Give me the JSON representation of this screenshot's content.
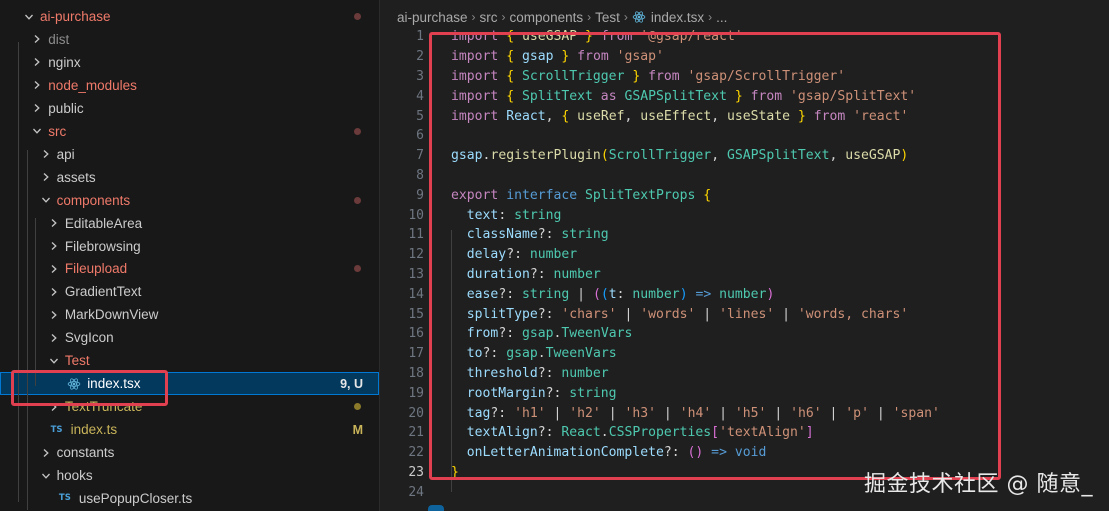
{
  "explorer": {
    "items": [
      {
        "label": "ai-purchase",
        "depth": 0,
        "kind": "folder-open",
        "color": "red",
        "status": "dot"
      },
      {
        "label": "dist",
        "depth": 1,
        "kind": "folder",
        "color": "grey"
      },
      {
        "label": "nginx",
        "depth": 1,
        "kind": "folder",
        "color": "normal"
      },
      {
        "label": "node_modules",
        "depth": 1,
        "kind": "folder",
        "color": "red"
      },
      {
        "label": "public",
        "depth": 1,
        "kind": "folder",
        "color": "normal"
      },
      {
        "label": "src",
        "depth": 1,
        "kind": "folder-open",
        "color": "red",
        "status": "dot"
      },
      {
        "label": "api",
        "depth": 2,
        "kind": "folder",
        "color": "normal"
      },
      {
        "label": "assets",
        "depth": 2,
        "kind": "folder",
        "color": "normal"
      },
      {
        "label": "components",
        "depth": 2,
        "kind": "folder-open",
        "color": "red",
        "status": "dot"
      },
      {
        "label": "EditableArea",
        "depth": 3,
        "kind": "folder",
        "color": "normal"
      },
      {
        "label": "Filebrowsing",
        "depth": 3,
        "kind": "folder",
        "color": "normal"
      },
      {
        "label": "Fileupload",
        "depth": 3,
        "kind": "folder",
        "color": "red",
        "status": "dot"
      },
      {
        "label": "GradientText",
        "depth": 3,
        "kind": "folder",
        "color": "normal"
      },
      {
        "label": "MarkDownView",
        "depth": 3,
        "kind": "folder",
        "color": "normal"
      },
      {
        "label": "SvgIcon",
        "depth": 3,
        "kind": "folder",
        "color": "normal"
      },
      {
        "label": "Test",
        "depth": 3,
        "kind": "folder-open",
        "color": "red"
      },
      {
        "label": "index.tsx",
        "depth": 4,
        "kind": "react-file",
        "color": "normal",
        "selected": true,
        "tag": "9, U"
      },
      {
        "label": "TextTruncate",
        "depth": 3,
        "kind": "folder",
        "color": "yellow",
        "status": "dot-yellow"
      },
      {
        "label": "index.ts",
        "depth": 2,
        "kind": "ts-file",
        "color": "yellow",
        "tag": "M"
      },
      {
        "label": "constants",
        "depth": 2,
        "kind": "folder",
        "color": "normal"
      },
      {
        "label": "hooks",
        "depth": 2,
        "kind": "folder-open",
        "color": "normal"
      },
      {
        "label": "usePopupCloser.ts",
        "depth": 3,
        "kind": "ts-file",
        "color": "normal"
      }
    ],
    "ts_badge": "TS"
  },
  "breadcrumb": [
    "ai-purchase",
    "src",
    "components",
    "Test",
    "index.tsx",
    "..."
  ],
  "code": {
    "lines": [
      [
        [
          "k",
          "import "
        ],
        [
          "b1",
          "{ "
        ],
        [
          "f",
          "useGSAP"
        ],
        [
          "b1",
          " } "
        ],
        [
          "k",
          "from "
        ],
        [
          "s",
          "'@gsap/react'"
        ]
      ],
      [
        [
          "k",
          "import "
        ],
        [
          "b1",
          "{ "
        ],
        [
          "v",
          "gsap"
        ],
        [
          "b1",
          " } "
        ],
        [
          "k",
          "from "
        ],
        [
          "s",
          "'gsap'"
        ]
      ],
      [
        [
          "k",
          "import "
        ],
        [
          "b1",
          "{ "
        ],
        [
          "t",
          "ScrollTrigger"
        ],
        [
          "b1",
          " } "
        ],
        [
          "k",
          "from "
        ],
        [
          "s",
          "'gsap/ScrollTrigger'"
        ]
      ],
      [
        [
          "k",
          "import "
        ],
        [
          "b1",
          "{ "
        ],
        [
          "t",
          "SplitText"
        ],
        [
          "k",
          " as "
        ],
        [
          "t",
          "GSAPSplitText"
        ],
        [
          "b1",
          " } "
        ],
        [
          "k",
          "from "
        ],
        [
          "s",
          "'gsap/SplitText'"
        ]
      ],
      [
        [
          "k",
          "import "
        ],
        [
          "v",
          "React"
        ],
        [
          "p",
          ", "
        ],
        [
          "b1",
          "{ "
        ],
        [
          "f",
          "useRef"
        ],
        [
          "p",
          ", "
        ],
        [
          "f",
          "useEffect"
        ],
        [
          "p",
          ", "
        ],
        [
          "f",
          "useState"
        ],
        [
          "b1",
          " } "
        ],
        [
          "k",
          "from "
        ],
        [
          "s",
          "'react'"
        ]
      ],
      [],
      [
        [
          "v",
          "gsap"
        ],
        [
          "p",
          "."
        ],
        [
          "f",
          "registerPlugin"
        ],
        [
          "b1",
          "("
        ],
        [
          "t",
          "ScrollTrigger"
        ],
        [
          "p",
          ", "
        ],
        [
          "t",
          "GSAPSplitText"
        ],
        [
          "p",
          ", "
        ],
        [
          "f",
          "useGSAP"
        ],
        [
          "b1",
          ")"
        ]
      ],
      [],
      [
        [
          "k",
          "export "
        ],
        [
          "kb",
          "interface "
        ],
        [
          "t",
          "SplitTextProps "
        ],
        [
          "b1",
          "{"
        ]
      ],
      [
        [
          "v",
          "  text"
        ],
        [
          "p",
          ": "
        ],
        [
          "t",
          "string"
        ]
      ],
      [
        [
          "v",
          "  className"
        ],
        [
          "p",
          "?: "
        ],
        [
          "t",
          "string"
        ]
      ],
      [
        [
          "v",
          "  delay"
        ],
        [
          "p",
          "?: "
        ],
        [
          "t",
          "number"
        ]
      ],
      [
        [
          "v",
          "  duration"
        ],
        [
          "p",
          "?: "
        ],
        [
          "t",
          "number"
        ]
      ],
      [
        [
          "v",
          "  ease"
        ],
        [
          "p",
          "?: "
        ],
        [
          "t",
          "string"
        ],
        [
          "p",
          " | "
        ],
        [
          "b2",
          "("
        ],
        [
          "b3",
          "("
        ],
        [
          "v",
          "t"
        ],
        [
          "p",
          ": "
        ],
        [
          "t",
          "number"
        ],
        [
          "b3",
          ")"
        ],
        [
          "kb",
          " => "
        ],
        [
          "t",
          "number"
        ],
        [
          "b2",
          ")"
        ]
      ],
      [
        [
          "v",
          "  splitType"
        ],
        [
          "p",
          "?: "
        ],
        [
          "s",
          "'chars'"
        ],
        [
          "p",
          " | "
        ],
        [
          "s",
          "'words'"
        ],
        [
          "p",
          " | "
        ],
        [
          "s",
          "'lines'"
        ],
        [
          "p",
          " | "
        ],
        [
          "s",
          "'words, chars'"
        ]
      ],
      [
        [
          "v",
          "  from"
        ],
        [
          "p",
          "?: "
        ],
        [
          "t",
          "gsap"
        ],
        [
          "p",
          "."
        ],
        [
          "t",
          "TweenVars"
        ]
      ],
      [
        [
          "v",
          "  to"
        ],
        [
          "p",
          "?: "
        ],
        [
          "t",
          "gsap"
        ],
        [
          "p",
          "."
        ],
        [
          "t",
          "TweenVars"
        ]
      ],
      [
        [
          "v",
          "  threshold"
        ],
        [
          "p",
          "?: "
        ],
        [
          "t",
          "number"
        ]
      ],
      [
        [
          "v",
          "  rootMargin"
        ],
        [
          "p",
          "?: "
        ],
        [
          "t",
          "string"
        ]
      ],
      [
        [
          "v",
          "  tag"
        ],
        [
          "p",
          "?: "
        ],
        [
          "s",
          "'h1'"
        ],
        [
          "p",
          " | "
        ],
        [
          "s",
          "'h2'"
        ],
        [
          "p",
          " | "
        ],
        [
          "s",
          "'h3'"
        ],
        [
          "p",
          " | "
        ],
        [
          "s",
          "'h4'"
        ],
        [
          "p",
          " | "
        ],
        [
          "s",
          "'h5'"
        ],
        [
          "p",
          " | "
        ],
        [
          "s",
          "'h6'"
        ],
        [
          "p",
          " | "
        ],
        [
          "s",
          "'p'"
        ],
        [
          "p",
          " | "
        ],
        [
          "s",
          "'span'"
        ]
      ],
      [
        [
          "v",
          "  textAlign"
        ],
        [
          "p",
          "?: "
        ],
        [
          "t",
          "React"
        ],
        [
          "p",
          "."
        ],
        [
          "t",
          "CSSProperties"
        ],
        [
          "b2",
          "["
        ],
        [
          "s",
          "'textAlign'"
        ],
        [
          "b2",
          "]"
        ]
      ],
      [
        [
          "v",
          "  onLetterAnimationComplete"
        ],
        [
          "p",
          "?: "
        ],
        [
          "b2",
          "()"
        ],
        [
          "kb",
          " => "
        ],
        [
          "kb",
          "void"
        ]
      ],
      [
        [
          "b1",
          "}"
        ]
      ],
      []
    ]
  },
  "watermark": "掘金技术社区 @ 随意_",
  "colors": {
    "highlight": "#e0404f",
    "selection": "#04395e",
    "accent": "#0078d4"
  }
}
